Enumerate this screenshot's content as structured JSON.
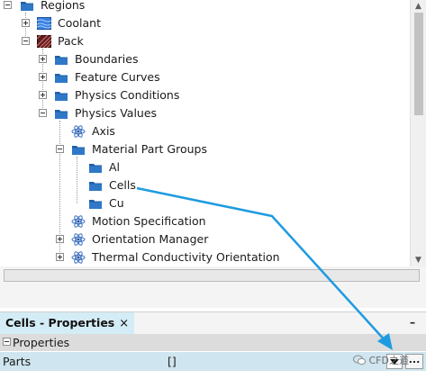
{
  "tree": {
    "items": [
      {
        "label": "Regions",
        "icon": "folder-icon",
        "toggle": "minus"
      },
      {
        "label": "Coolant",
        "icon": "mesh-region-icon",
        "toggle": "plus"
      },
      {
        "label": "Pack",
        "icon": "hatched-region-icon",
        "toggle": "minus"
      },
      {
        "label": "Boundaries",
        "icon": "folder-icon",
        "toggle": "plus"
      },
      {
        "label": "Feature Curves",
        "icon": "folder-icon",
        "toggle": "plus"
      },
      {
        "label": "Physics Conditions",
        "icon": "folder-icon",
        "toggle": "plus"
      },
      {
        "label": "Physics Values",
        "icon": "folder-icon",
        "toggle": "minus"
      },
      {
        "label": "Axis",
        "icon": "atom-icon",
        "toggle": "none"
      },
      {
        "label": "Material Part Groups",
        "icon": "folder-icon",
        "toggle": "minus"
      },
      {
        "label": "Al",
        "icon": "folder-icon",
        "toggle": "none"
      },
      {
        "label": "Cells",
        "icon": "folder-icon",
        "toggle": "none"
      },
      {
        "label": "Cu",
        "icon": "folder-icon",
        "toggle": "none"
      },
      {
        "label": "Motion Specification",
        "icon": "atom-icon",
        "toggle": "none"
      },
      {
        "label": "Orientation Manager",
        "icon": "atom-icon",
        "toggle": "plus"
      },
      {
        "label": "Thermal Conductivity Orientation",
        "icon": "atom-icon",
        "toggle": "plus"
      }
    ]
  },
  "properties_panel": {
    "tab_title": "Cells - Properties",
    "close_glyph": "×",
    "minimize_glyph": "–",
    "section_title": "Properties",
    "rows": [
      {
        "name": "Parts",
        "value": "[]"
      }
    ],
    "more_button_label": "...",
    "watermark_text": "CFD之道"
  },
  "colors": {
    "folder": "#1f5fa8",
    "selected_tab": "#d4ecf5",
    "property_row": "#cfe5ef",
    "annotation_arrow": "#1e9be0"
  }
}
